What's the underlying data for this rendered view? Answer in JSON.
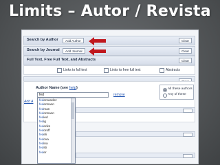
{
  "slide": {
    "title": "Limits – Autor / Revista"
  },
  "panels": {
    "author_search": {
      "label": "Search by Author",
      "button": "Add Author",
      "clear": "Clear"
    },
    "journal_search": {
      "label": "Search by Journal",
      "button": "Add Journal",
      "clear": "Clear"
    },
    "fulltext": {
      "label": "Full Text, Free Full Text, and Abstracts",
      "clear": "Clear",
      "options": [
        "Links to full text",
        "Links to free full text",
        "Abstracts"
      ]
    },
    "author_name": {
      "header": "Author Name (see",
      "help": "help",
      "header_close": ")",
      "input_value": "fed",
      "remove": "remove",
      "add": "Add A",
      "clear": "Clear",
      "match_options": [
        "All these authors",
        "Any of these"
      ]
    }
  },
  "autocomplete": {
    "items": [
      {
        "prefix": "fed",
        "rest": "ernandez"
      },
      {
        "prefix": "fed",
        "rest": "ermann"
      },
      {
        "prefix": "fed",
        "rest": "man"
      },
      {
        "prefix": "fed",
        "rest": "ormann"
      },
      {
        "prefix": "fed",
        "rest": "ied"
      },
      {
        "prefix": "fed",
        "rest": "ig"
      },
      {
        "prefix": "fed",
        "rest": "eriks"
      },
      {
        "prefix": "fed",
        "rest": "oroff"
      },
      {
        "prefix": "fed",
        "rest": "eli"
      },
      {
        "prefix": "fed",
        "rest": "ova"
      },
      {
        "prefix": "fed",
        "rest": "ina"
      },
      {
        "prefix": "fed",
        "rest": "sti"
      },
      {
        "prefix": "fed",
        "rest": "er"
      }
    ]
  },
  "colors": {
    "arrow": "#c0171d",
    "background": "#55585a",
    "link": "#2457b3"
  }
}
